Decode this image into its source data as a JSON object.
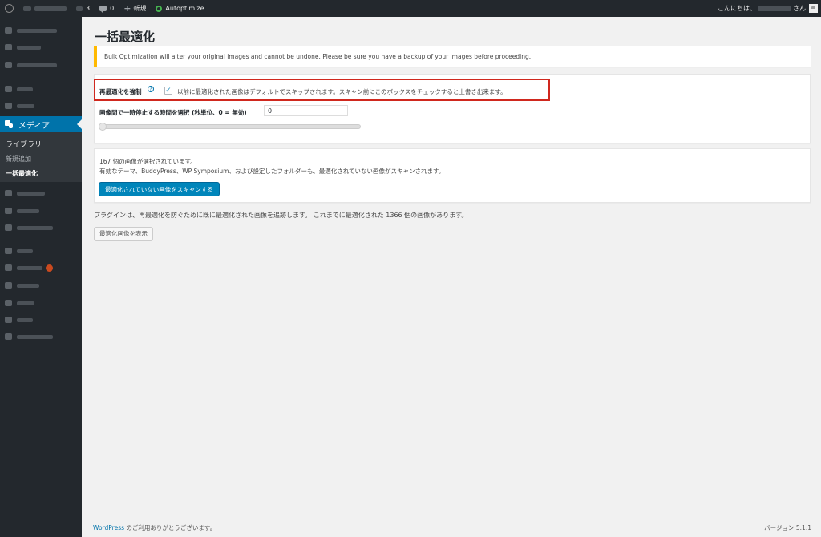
{
  "admin_bar": {
    "updates_count": "3",
    "comments_count": "0",
    "new_label": "新規",
    "plugin_label": "Autoptimize",
    "greeting": "こんにちは、",
    "greeting_suffix": "さん"
  },
  "sidebar": {
    "media_label": "メディア",
    "submenu": [
      "ライブラリ",
      "新規追加",
      "一括最適化"
    ]
  },
  "page": {
    "title": "一括最適化",
    "notice": "Bulk Optimization will alter your original images and cannot be undone. Please be sure you have a backup of your images before proceeding.",
    "force_label": "再最適化を強制",
    "help_glyph": "?",
    "force_checked": true,
    "force_description": "以前に最適化された画像はデフォルトでスキップされます。スキャン前にこのボックスをチェックすると上書き出来ます。",
    "pause_label": "画像間で一時停止する時間を選択 (秒単位、0 = 無効)",
    "pause_value": "0",
    "selected_text": "167 個の画像が選択されています。",
    "scan_info": "有効なテーマ、BuddyPress、WP Symposium、および設定したフォルダーも、最適化されていない画像がスキャンされます。",
    "scan_button": "最適化されていない画像をスキャンする",
    "plugin_info": "プラグインは、再最適化を防ぐために既に最適化された画像を追跡します。 これまでに最適化された 1366 個の画像があります。",
    "show_button": "最適化画像を表示"
  },
  "footer": {
    "wordpress_link": "WordPress",
    "thanks": " のご利用ありがとうございます。",
    "version": "バージョン 5.1.1"
  },
  "colors": {
    "accent": "#0073aa",
    "button_primary": "#0085ba",
    "highlight_border": "#d0281e",
    "notice_border": "#ffb900",
    "admin_bg": "#23282d"
  }
}
